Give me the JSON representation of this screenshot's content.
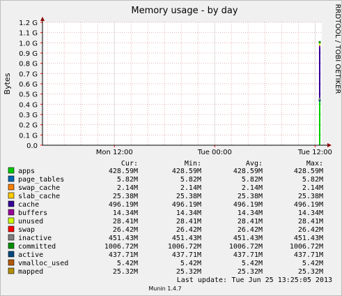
{
  "side_label": "RRDTOOL / TOBI OETIKER",
  "footer": {
    "last_update_label": "Last update:",
    "last_update_value": "Tue Jun 25 13:25:05 2013",
    "version": "Munin 1.4.7"
  },
  "colors": {
    "grid_minor": "#e8b0b0",
    "grid_major": "#e0e0e0",
    "axis": "#8b0000",
    "plot_bg": "#ffffff",
    "frame_bg": "#f0f0f0"
  },
  "legend": {
    "headers": [
      "Cur:",
      "Min:",
      "Avg:",
      "Max:"
    ],
    "rows": [
      {
        "name": "apps",
        "color": "#00cc00",
        "cur": "428.59M",
        "min": "428.59M",
        "avg": "428.59M",
        "max": "428.59M"
      },
      {
        "name": "page_tables",
        "color": "#0066b3",
        "cur": "5.82M",
        "min": "5.82M",
        "avg": "5.82M",
        "max": "5.82M"
      },
      {
        "name": "swap_cache",
        "color": "#ff8000",
        "cur": "2.14M",
        "min": "2.14M",
        "avg": "2.14M",
        "max": "2.14M"
      },
      {
        "name": "slab_cache",
        "color": "#ffcc00",
        "cur": "25.38M",
        "min": "25.38M",
        "avg": "25.38M",
        "max": "25.38M"
      },
      {
        "name": "cache",
        "color": "#330099",
        "cur": "496.19M",
        "min": "496.19M",
        "avg": "496.19M",
        "max": "496.19M"
      },
      {
        "name": "buffers",
        "color": "#990099",
        "cur": "14.34M",
        "min": "14.34M",
        "avg": "14.34M",
        "max": "14.34M"
      },
      {
        "name": "unused",
        "color": "#ccff00",
        "cur": "28.41M",
        "min": "28.41M",
        "avg": "28.41M",
        "max": "28.41M"
      },
      {
        "name": "swap",
        "color": "#ff0000",
        "cur": "26.42M",
        "min": "26.42M",
        "avg": "26.42M",
        "max": "26.42M"
      },
      {
        "name": "inactive",
        "color": "#808080",
        "cur": "451.43M",
        "min": "451.43M",
        "avg": "451.43M",
        "max": "451.43M"
      },
      {
        "name": "committed",
        "color": "#008f00",
        "cur": "1006.72M",
        "min": "1006.72M",
        "avg": "1006.72M",
        "max": "1006.72M"
      },
      {
        "name": "active",
        "color": "#00487d",
        "cur": "437.71M",
        "min": "437.71M",
        "avg": "437.71M",
        "max": "437.71M"
      },
      {
        "name": "vmalloc_used",
        "color": "#b35a00",
        "cur": "5.42M",
        "min": "5.42M",
        "avg": "5.42M",
        "max": "5.42M"
      },
      {
        "name": "mapped",
        "color": "#b38f00",
        "cur": "25.32M",
        "min": "25.32M",
        "avg": "25.32M",
        "max": "25.32M"
      }
    ]
  },
  "chart_data": {
    "type": "line",
    "title": "Memory usage - by day",
    "ylabel": "Bytes",
    "xlabel": "",
    "y_ticks": [
      "0.0",
      "0.1 G",
      "0.2 G",
      "0.3 G",
      "0.4 G",
      "0.5 G",
      "0.6 G",
      "0.7 G",
      "0.8 G",
      "0.9 G",
      "1.0 G",
      "1.1 G",
      "1.2 G"
    ],
    "ylim": [
      0,
      1.2
    ],
    "x_ticks": [
      "Mon 12:00",
      "Tue 00:00",
      "Tue 12:00"
    ],
    "grid": true,
    "stack_series": [
      {
        "name": "apps",
        "value": 0.42859
      },
      {
        "name": "page_tables",
        "value": 0.00582
      },
      {
        "name": "swap_cache",
        "value": 0.00214
      },
      {
        "name": "slab_cache",
        "value": 0.02538
      },
      {
        "name": "cache",
        "value": 0.49619
      },
      {
        "name": "buffers",
        "value": 0.01434
      },
      {
        "name": "unused",
        "value": 0.02841
      }
    ],
    "line_series": [
      {
        "name": "committed",
        "value": 1.00672
      },
      {
        "name": "active",
        "value": 0.43771
      },
      {
        "name": "inactive",
        "value": 0.45143
      }
    ]
  }
}
